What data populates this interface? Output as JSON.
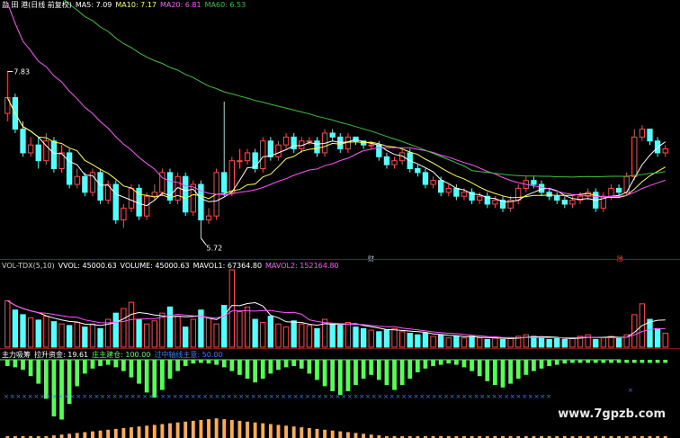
{
  "colors": {
    "up": "#ff4a4a",
    "down": "#54ffff",
    "ma5": "#ffffff",
    "ma10": "#ffff55",
    "ma20": "#ff55ff",
    "ma60": "#3fbf3f",
    "vol_ma1": "#ffffff",
    "vol_ma2": "#ff55ff",
    "flow_green": "#55ff55",
    "flow_bar": "#ffaa55",
    "marker": "#3a7fff"
  },
  "header_main": {
    "name": "盐 田 港(日线 前复权)",
    "ma5": "MA5: 7.09",
    "ma10": "MA10: 7.17",
    "ma20": "MA20: 6.81",
    "ma60": "MA60: 6.53"
  },
  "header_vol": {
    "name": "VOL-TDX(5,10)",
    "vvol": "VVOL: 45000.63",
    "volume": "VOLUME: 45000.63",
    "mavol1": "MAVOL1: 67364.80",
    "mavol2": "MAVOL2: 152164.80"
  },
  "header_ind": {
    "name": "主力吸筹",
    "funds": "拉升资金: 19.61",
    "main_pos": "庄主建仓: 100.00",
    "line": "过中轴线主意: 50.00"
  },
  "annotations": {
    "high_label": "7.83",
    "low_label": "5.72",
    "mark_a": "财",
    "mark_b": "除"
  },
  "watermark": "www.7gpzb.com",
  "chart_data": [
    {
      "type": "candlestick",
      "title": "盐 田 港(日线 前复权)",
      "ylim": [
        5.5,
        8.6
      ],
      "series_names": [
        "MA5",
        "MA10",
        "MA20",
        "MA60"
      ],
      "open": [
        7.3,
        7.5,
        7.1,
        6.8,
        6.9,
        6.7,
        6.95,
        6.6,
        6.8,
        6.4,
        6.5,
        6.3,
        6.55,
        6.2,
        6.4,
        5.95,
        6.1,
        6.35,
        6.0,
        6.25,
        6.3,
        6.55,
        6.2,
        6.5,
        6.05,
        6.4,
        5.95,
        6.0,
        6.55,
        6.3,
        6.7,
        6.7,
        6.8,
        6.6,
        6.95,
        6.75,
        6.9,
        7.0,
        6.85,
        6.95,
        6.95,
        6.8,
        7.05,
        7.0,
        6.85,
        7.0,
        6.95,
        6.9,
        6.9,
        6.75,
        6.65,
        6.7,
        6.8,
        6.6,
        6.55,
        6.4,
        6.45,
        6.3,
        6.35,
        6.25,
        6.3,
        6.2,
        6.25,
        6.15,
        6.2,
        6.1,
        6.2,
        6.35,
        6.45,
        6.4,
        6.3,
        6.25,
        6.2,
        6.15,
        6.2,
        6.25,
        6.3,
        6.1,
        6.25,
        6.35,
        6.3,
        6.5,
        7.0,
        7.1,
        6.95,
        6.8
      ],
      "close": [
        7.5,
        7.1,
        6.8,
        6.9,
        6.7,
        6.95,
        6.6,
        6.8,
        6.4,
        6.5,
        6.3,
        6.55,
        6.2,
        6.4,
        5.95,
        6.1,
        6.35,
        6.0,
        6.25,
        6.3,
        6.55,
        6.2,
        6.5,
        6.05,
        6.4,
        5.95,
        6.0,
        6.55,
        6.3,
        6.7,
        6.7,
        6.8,
        6.6,
        6.95,
        6.75,
        6.9,
        7.0,
        6.85,
        6.95,
        6.95,
        6.8,
        7.05,
        7.0,
        6.85,
        7.0,
        6.95,
        6.9,
        6.9,
        6.75,
        6.65,
        6.7,
        6.8,
        6.6,
        6.55,
        6.4,
        6.45,
        6.3,
        6.35,
        6.25,
        6.3,
        6.2,
        6.25,
        6.15,
        6.2,
        6.1,
        6.2,
        6.35,
        6.45,
        6.4,
        6.3,
        6.25,
        6.2,
        6.15,
        6.2,
        6.25,
        6.3,
        6.1,
        6.25,
        6.35,
        6.3,
        6.5,
        7.0,
        7.1,
        6.95,
        6.8,
        6.85
      ],
      "high": [
        7.83,
        7.55,
        7.2,
        7.0,
        7.0,
        7.05,
        7.0,
        6.9,
        6.85,
        6.6,
        6.55,
        6.6,
        6.6,
        6.45,
        6.45,
        6.15,
        6.4,
        6.4,
        6.3,
        6.4,
        6.6,
        6.6,
        6.55,
        6.55,
        6.45,
        6.45,
        6.1,
        6.6,
        7.45,
        6.75,
        6.85,
        6.85,
        6.85,
        7.0,
        7.0,
        6.95,
        7.05,
        7.05,
        7.0,
        7.0,
        7.0,
        7.1,
        7.1,
        7.05,
        7.05,
        7.0,
        6.95,
        6.95,
        6.95,
        6.8,
        6.75,
        6.85,
        6.85,
        6.65,
        6.6,
        6.5,
        6.5,
        6.4,
        6.4,
        6.35,
        6.35,
        6.3,
        6.3,
        6.25,
        6.25,
        6.25,
        6.4,
        6.5,
        6.5,
        6.45,
        6.35,
        6.3,
        6.25,
        6.25,
        6.3,
        6.35,
        6.35,
        6.3,
        6.4,
        6.4,
        6.55,
        7.1,
        7.15,
        7.1,
        7.0,
        6.9
      ],
      "low": [
        7.2,
        7.05,
        6.75,
        6.75,
        6.6,
        6.65,
        6.55,
        6.55,
        6.35,
        6.35,
        6.25,
        6.25,
        6.15,
        6.15,
        5.9,
        5.85,
        6.05,
        5.95,
        5.95,
        6.2,
        6.25,
        6.15,
        6.15,
        6.0,
        6.0,
        5.72,
        5.9,
        5.95,
        6.25,
        6.25,
        6.6,
        6.65,
        6.55,
        6.55,
        6.7,
        6.7,
        6.85,
        6.8,
        6.8,
        6.9,
        6.75,
        6.75,
        6.95,
        6.8,
        6.8,
        6.9,
        6.85,
        6.85,
        6.7,
        6.6,
        6.6,
        6.65,
        6.55,
        6.5,
        6.35,
        6.35,
        6.25,
        6.25,
        6.2,
        6.2,
        6.15,
        6.15,
        6.1,
        6.1,
        6.05,
        6.05,
        6.15,
        6.3,
        6.35,
        6.25,
        6.2,
        6.15,
        6.1,
        6.1,
        6.15,
        6.2,
        6.05,
        6.05,
        6.2,
        6.25,
        6.25,
        6.45,
        6.95,
        6.9,
        6.75,
        6.75
      ]
    },
    {
      "type": "bar",
      "title": "VOL-TDX(5,10)",
      "ylim": [
        0,
        100
      ],
      "series_names": [
        "MAVOL1",
        "MAVOL2"
      ],
      "values": [
        60,
        48,
        42,
        38,
        35,
        40,
        33,
        30,
        28,
        32,
        26,
        30,
        24,
        36,
        44,
        50,
        58,
        36,
        30,
        34,
        44,
        52,
        40,
        26,
        36,
        48,
        38,
        30,
        54,
        100,
        46,
        52,
        36,
        32,
        40,
        30,
        26,
        34,
        30,
        28,
        24,
        36,
        30,
        28,
        32,
        26,
        24,
        22,
        20,
        22,
        24,
        20,
        18,
        16,
        18,
        14,
        16,
        12,
        14,
        12,
        14,
        12,
        10,
        12,
        10,
        12,
        14,
        16,
        14,
        12,
        10,
        12,
        10,
        12,
        14,
        16,
        10,
        12,
        14,
        12,
        16,
        42,
        56,
        36,
        24,
        18
      ]
    },
    {
      "type": "bar",
      "title": "主力吸筹",
      "ylim": [
        -100,
        10
      ],
      "values": [
        -10,
        -12,
        -16,
        -26,
        -38,
        -62,
        -90,
        -95,
        -70,
        -42,
        -22,
        -14,
        -10,
        -8,
        -12,
        -18,
        -28,
        -38,
        -52,
        -60,
        -48,
        -30,
        -18,
        -10,
        -6,
        -5,
        -6,
        -8,
        -12,
        -18,
        -24,
        -30,
        -36,
        -30,
        -22,
        -16,
        -12,
        -10,
        -14,
        -22,
        -32,
        -42,
        -50,
        -56,
        -50,
        -40,
        -30,
        -24,
        -32,
        -40,
        -48,
        -40,
        -30,
        -20,
        -14,
        -10,
        -8,
        -6,
        -8,
        -12,
        -18,
        -26,
        -34,
        -40,
        -44,
        -38,
        -30,
        -24,
        -18,
        -14,
        -10,
        -8,
        -6,
        -5,
        -5,
        -5,
        -5,
        -5,
        -5,
        -5,
        -5,
        -5,
        -5,
        -5,
        -5,
        -5
      ]
    }
  ]
}
